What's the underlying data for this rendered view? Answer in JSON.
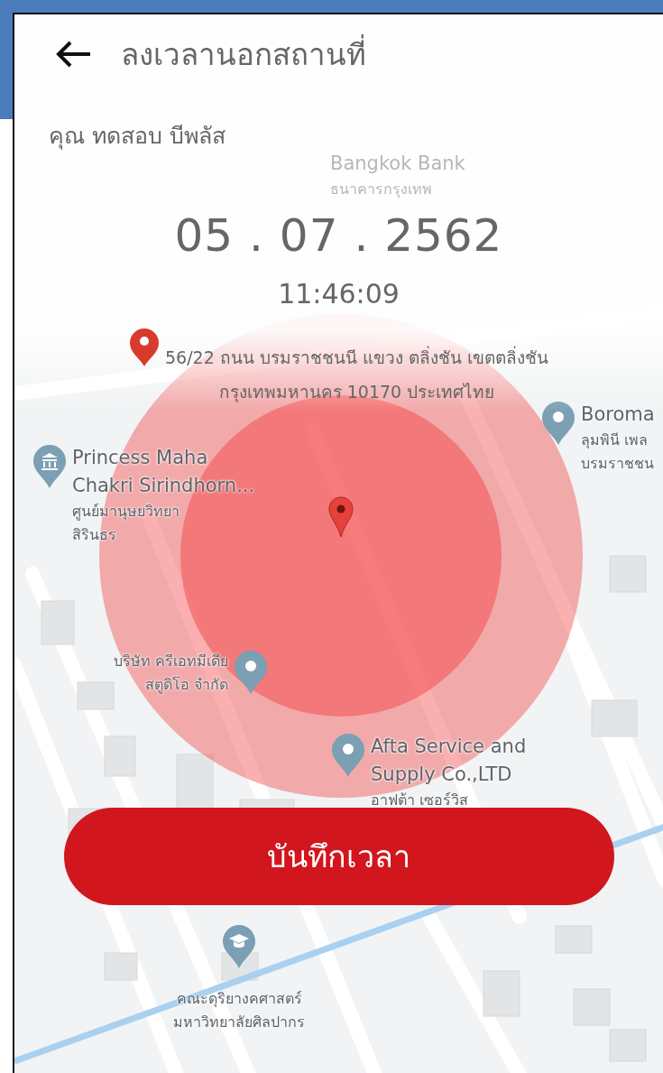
{
  "header": {
    "title": "ลงเวลานอกสถานที่"
  },
  "employee_name": "คุณ ทดสอบ บีพลัส",
  "date": "05 . 07 . 2562",
  "time": "11:46:09",
  "address_lines": [
    "56/22 ถนน บรมราชชนนี แขวง ตลิ่งชัน เขตตลิ่งชัน",
    "กรุงเทพมหานคร 10170 ประเทศไทย"
  ],
  "map": {
    "places": [
      {
        "kind": "bank",
        "name_lines": [
          "Bangkok Bank"
        ],
        "sub_lines": [
          "ธนาคารกรุงเทพ"
        ]
      },
      {
        "kind": "pin",
        "name_lines": [
          "Boroma"
        ],
        "sub_lines": [
          "ลุมพินี เพล",
          "บรมราชชน"
        ]
      },
      {
        "kind": "museum",
        "name_lines": [
          "Princess Maha",
          "Chakri Sirindhorn..."
        ],
        "sub_lines": [
          "ศูนย์มานุษยวิทยา",
          "สิรินธร"
        ]
      },
      {
        "kind": "pin",
        "sub_lines": [
          "บริษัท ครีเอทมีเดีย",
          "สตูดิโอ จำกัด"
        ]
      },
      {
        "kind": "pin",
        "name_lines": [
          "Afta Service and",
          "Supply Co.,LTD"
        ],
        "sub_lines": [
          "อาฟต้า เซอร์วิส"
        ]
      },
      {
        "kind": "school",
        "sub_lines": [
          "คณะดุริยางคศาสตร์",
          "มหาวิทยาลัยศิลปากร"
        ]
      }
    ]
  },
  "button": {
    "label": "บันทึกเวลา"
  }
}
